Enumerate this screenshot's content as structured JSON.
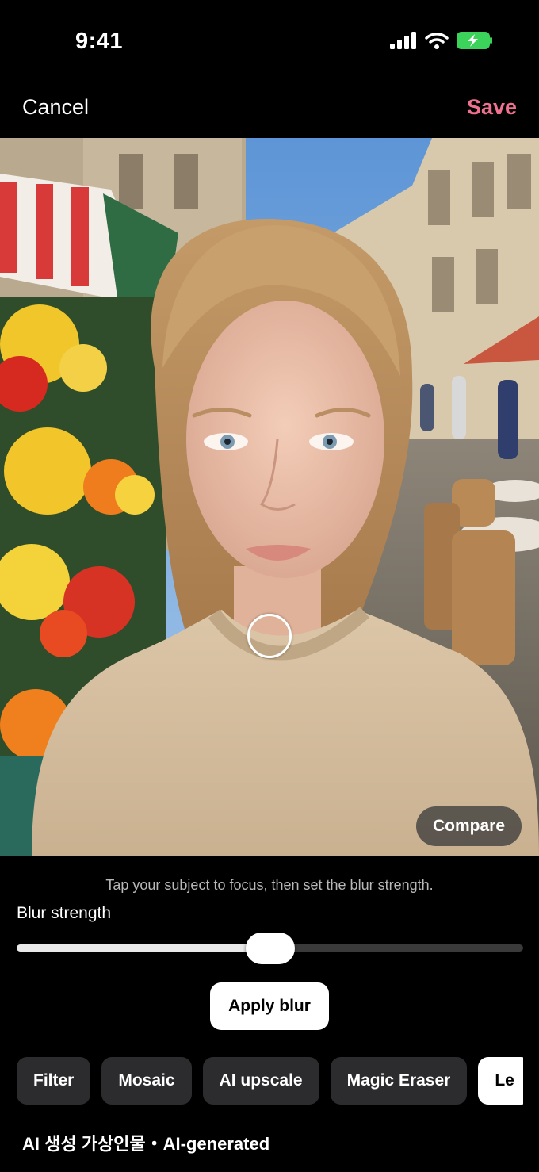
{
  "status_bar": {
    "time": "9:41"
  },
  "nav": {
    "cancel_label": "Cancel",
    "save_label": "Save",
    "save_color": "#f0708f"
  },
  "photo": {
    "compare_label": "Compare"
  },
  "controls": {
    "hint": "Tap your subject to focus, then set the blur strength.",
    "blur_label": "Blur strength",
    "blur_value": 0.5,
    "apply_label": "Apply blur"
  },
  "tools": [
    {
      "label": "Filter"
    },
    {
      "label": "Mosaic"
    },
    {
      "label": "AI upscale"
    },
    {
      "label": "Magic Eraser"
    },
    {
      "label": "Le",
      "active": true
    }
  ],
  "footer": {
    "text": "AI 생성 가상인물・AI-generated"
  }
}
